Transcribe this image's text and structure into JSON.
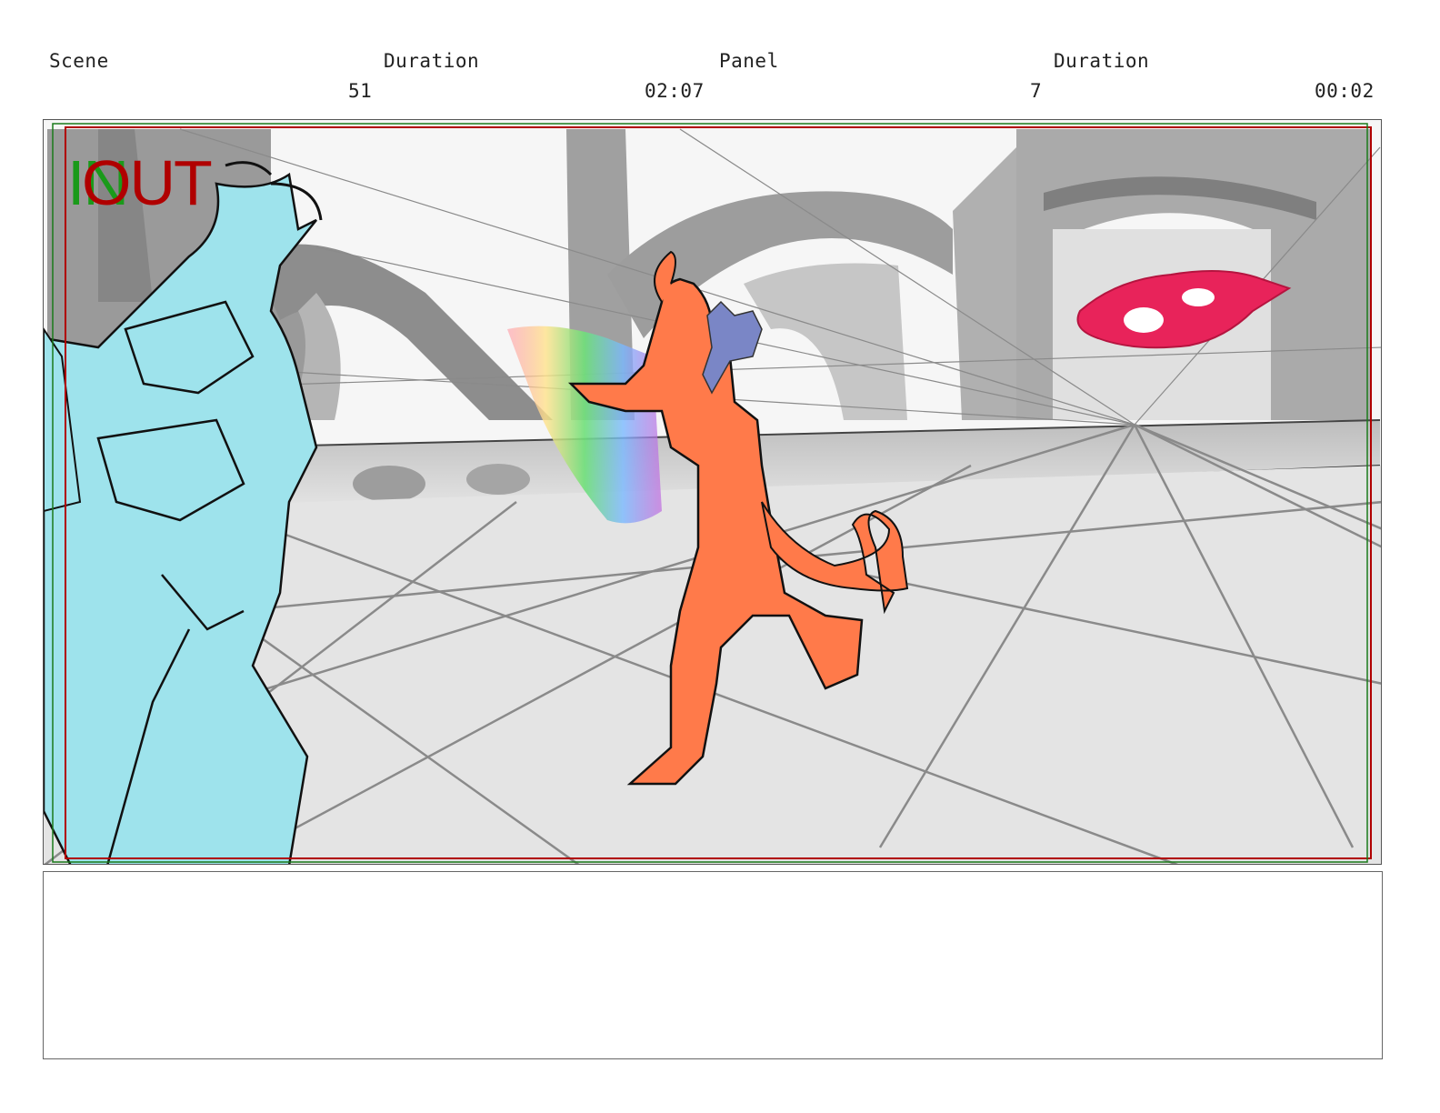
{
  "header": {
    "scene_label": "Scene",
    "scene_duration_label": "Duration",
    "panel_label": "Panel",
    "panel_duration_label": "Duration",
    "scene_number": "51",
    "scene_duration": "02:07",
    "panel_number": "7",
    "panel_duration": "00:02"
  },
  "frame": {
    "in_marker": "IN",
    "out_marker": "OUT",
    "in_color": "#1a9a1a",
    "out_color": "#b00000"
  },
  "colors": {
    "demon_left": "#9ee3ec",
    "demon_center": "#ff7a4a",
    "familiar": "#7a86c6",
    "target": "#e8235a",
    "floor": "#e4e4e4",
    "architecture": "#a8a8a8"
  },
  "notes": {
    "text": ""
  }
}
